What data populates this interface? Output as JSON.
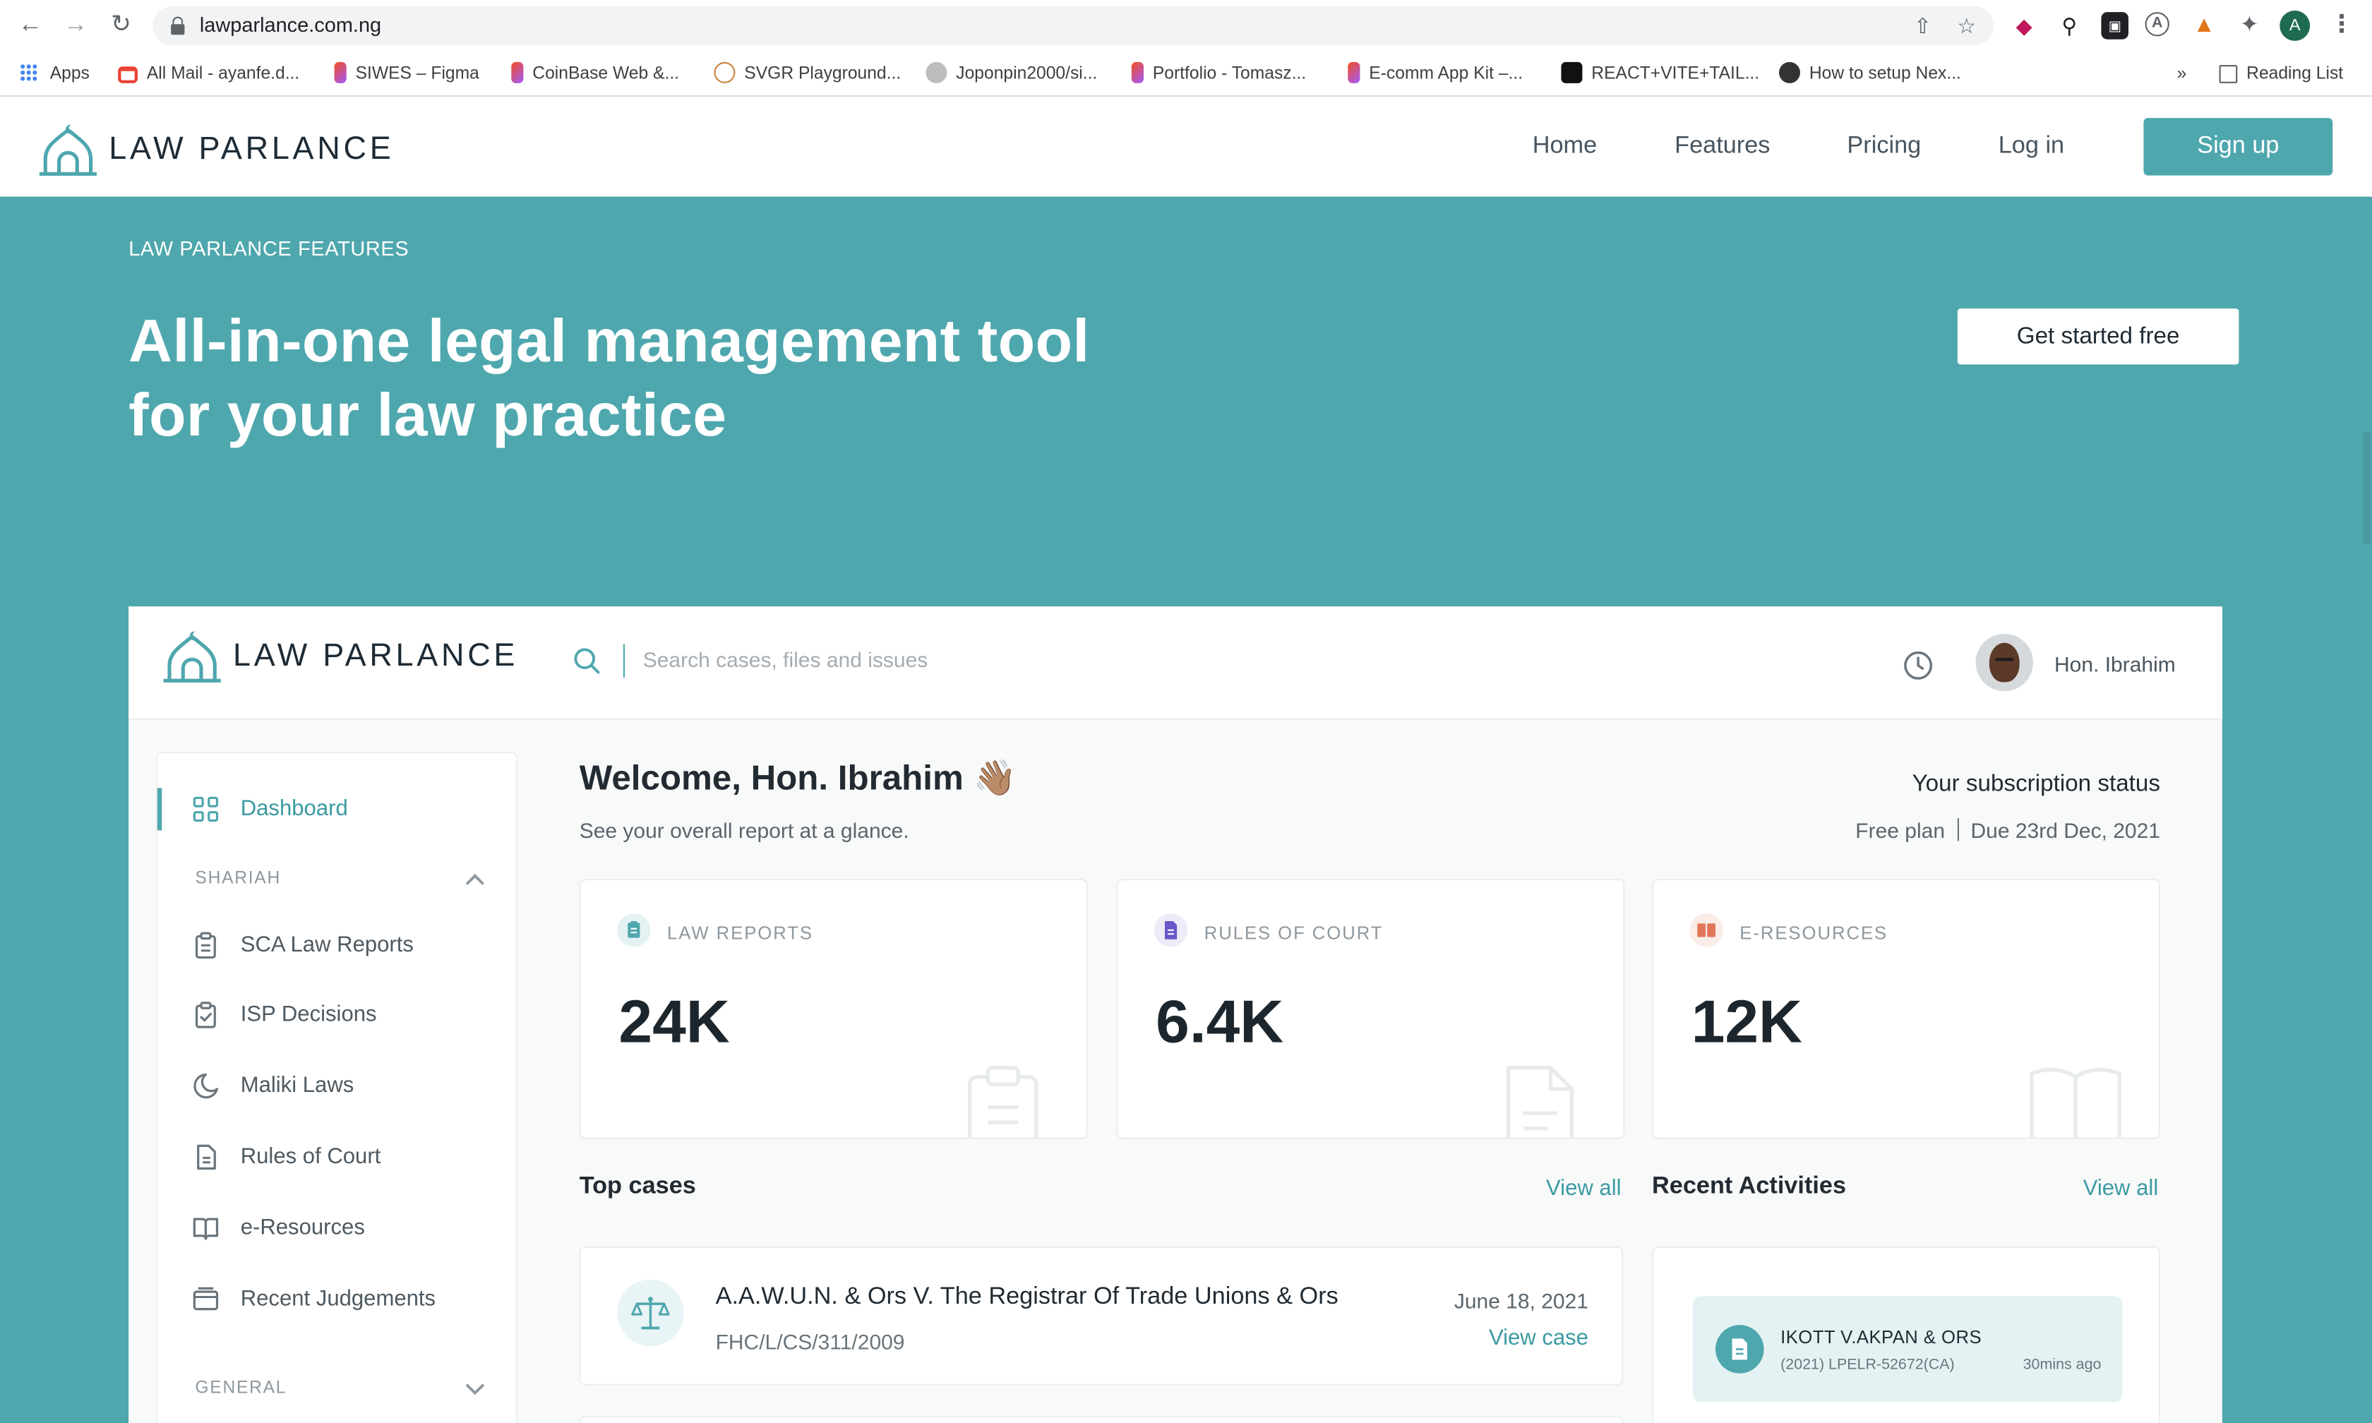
{
  "browser": {
    "url": "lawparlance.com.ng",
    "bookmarks": [
      {
        "label": "Apps"
      },
      {
        "label": "All Mail - ayanfe.d..."
      },
      {
        "label": "SIWES – Figma"
      },
      {
        "label": "CoinBase Web &..."
      },
      {
        "label": "SVGR Playground..."
      },
      {
        "label": "Joponpin2000/si..."
      },
      {
        "label": "Portfolio - Tomasz..."
      },
      {
        "label": "E-comm App Kit –..."
      },
      {
        "label": "REACT+VITE+TAIL..."
      },
      {
        "label": "How to setup Nex..."
      }
    ],
    "overflow": "»",
    "reading_list": "Reading List",
    "profile_initial": "A"
  },
  "site": {
    "brand": "LAW PARLANCE",
    "nav": [
      {
        "label": "Home"
      },
      {
        "label": "Features"
      },
      {
        "label": "Pricing"
      },
      {
        "label": "Log in"
      }
    ],
    "signup": "Sign up"
  },
  "hero": {
    "eyebrow": "LAW PARLANCE FEATURES",
    "headline_line1": "All-in-one legal management tool",
    "headline_line2": "for your law practice",
    "cta": "Get started free"
  },
  "app": {
    "brand": "LAW PARLANCE",
    "search_placeholder": "Search cases, files and issues",
    "user_name": "Hon. Ibrahim",
    "sidebar": {
      "dashboard": "Dashboard",
      "section_shariah": "SHARIAH",
      "items": [
        {
          "label": "SCA Law Reports",
          "icon": "clipboard-icon"
        },
        {
          "label": "ISP Decisions",
          "icon": "clipboard-check-icon"
        },
        {
          "label": "Maliki Laws",
          "icon": "moon-icon"
        },
        {
          "label": "Rules of Court",
          "icon": "document-icon"
        },
        {
          "label": "e-Resources",
          "icon": "book-icon"
        },
        {
          "label": "Recent Judgements",
          "icon": "folder-icon"
        }
      ],
      "section_general": "GENERAL"
    },
    "welcome": "Welcome, Hon. Ibrahim 👋🏽",
    "welcome_sub": "See your overall report at a glance.",
    "subscription": {
      "title": "Your subscription status",
      "plan": "Free plan",
      "due": "Due 23rd Dec, 2021"
    },
    "stats": [
      {
        "label": "LAW REPORTS",
        "value": "24K",
        "color": "#4fa7ae"
      },
      {
        "label": "RULES OF COURT",
        "value": "6.4K",
        "color": "#6b57c9"
      },
      {
        "label": "E-RESOURCES",
        "value": "12K",
        "color": "#e0765a"
      }
    ],
    "top_cases": {
      "title": "Top cases",
      "view_all": "View all",
      "items": [
        {
          "title": "A.A.W.U.N. & Ors V. The Registrar Of Trade Unions & Ors",
          "citation": "FHC/L/CS/311/2009",
          "date": "June 18, 2021",
          "action": "View case"
        }
      ]
    },
    "recent_activities": {
      "title": "Recent Activities",
      "view_all": "View all",
      "items": [
        {
          "title": "IKOTT V.AKPAN & ORS",
          "citation": "(2021) LPELR-52672(CA)",
          "time": "30mins ago"
        }
      ]
    }
  },
  "colors": {
    "brand_teal": "#4fa7ae",
    "text_dark": "#222b32"
  }
}
